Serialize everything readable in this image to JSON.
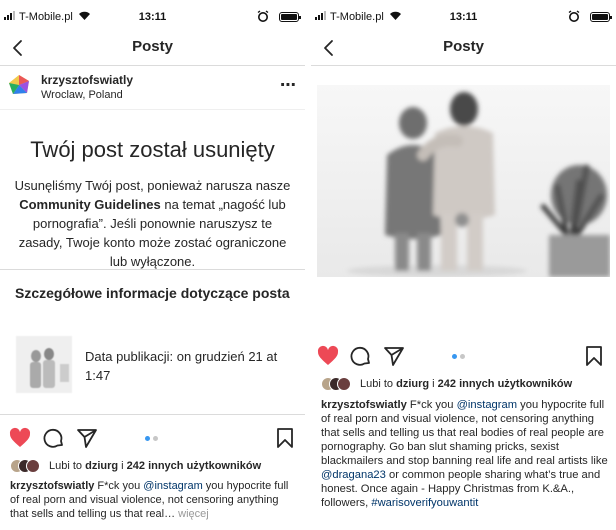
{
  "colors": {
    "like": "#ed4956",
    "link": "#003569",
    "accent": "#3897f0",
    "muted": "#999999"
  },
  "status": {
    "carrier": "T-Mobile.pl",
    "time": "13:11"
  },
  "left": {
    "nav_title": "Posty",
    "username": "krzysztofswiatly",
    "location": "Wroclaw, Poland",
    "more_icon": "⋯",
    "removed_title": "Twój post został usunięty",
    "removed_body_1": "Usunęliśmy Twój post, ponieważ narusza nasze ",
    "removed_body_link": "Community Guidelines",
    "removed_body_2": " na temat „nagość lub pornografia”. Jeśli ponownie naruszysz te zasady, Twoje konto może zostać ograniczone lub wyłączone.",
    "details_title": "Szczegółowe informacje dotyczące posta",
    "pub_date": "Data publikacji: on grudzień 21 at 1:47",
    "likes_prefix": "Lubi to ",
    "likes_user": "dziurg",
    "likes_mid": " i ",
    "likes_count": "242 innych użytkowników",
    "caption_user": "krzysztofswiatly",
    "caption_1": " F*ck you ",
    "caption_mention": "@instagram",
    "caption_2": " you hypocrite full of real porn and visual violence, not censoring anything that sells and telling us that real…",
    "caption_more": " więcej"
  },
  "right": {
    "nav_title": "Posty",
    "likes_prefix": "Lubi to ",
    "likes_user": "dziurg",
    "likes_mid": " i ",
    "likes_count": "242 innych użytkowników",
    "caption_user": "krzysztofswiatly",
    "caption_1": " F*ck you ",
    "caption_mention_1": "@instagram",
    "caption_2": " you hypocrite full of real porn and visual violence, not censoring anything that sells and telling us that real bodies of real people are pornography. Go ban slut shaming pricks, sexist blackmailers and stop banning real life and real artists like ",
    "caption_mention_2": "@dragana23",
    "caption_3": " or common people sharing what’s true and honest. Once again - Happy Christmas from K.&A., followers, ",
    "caption_hashtag": "#warisoverifyouwantit"
  }
}
